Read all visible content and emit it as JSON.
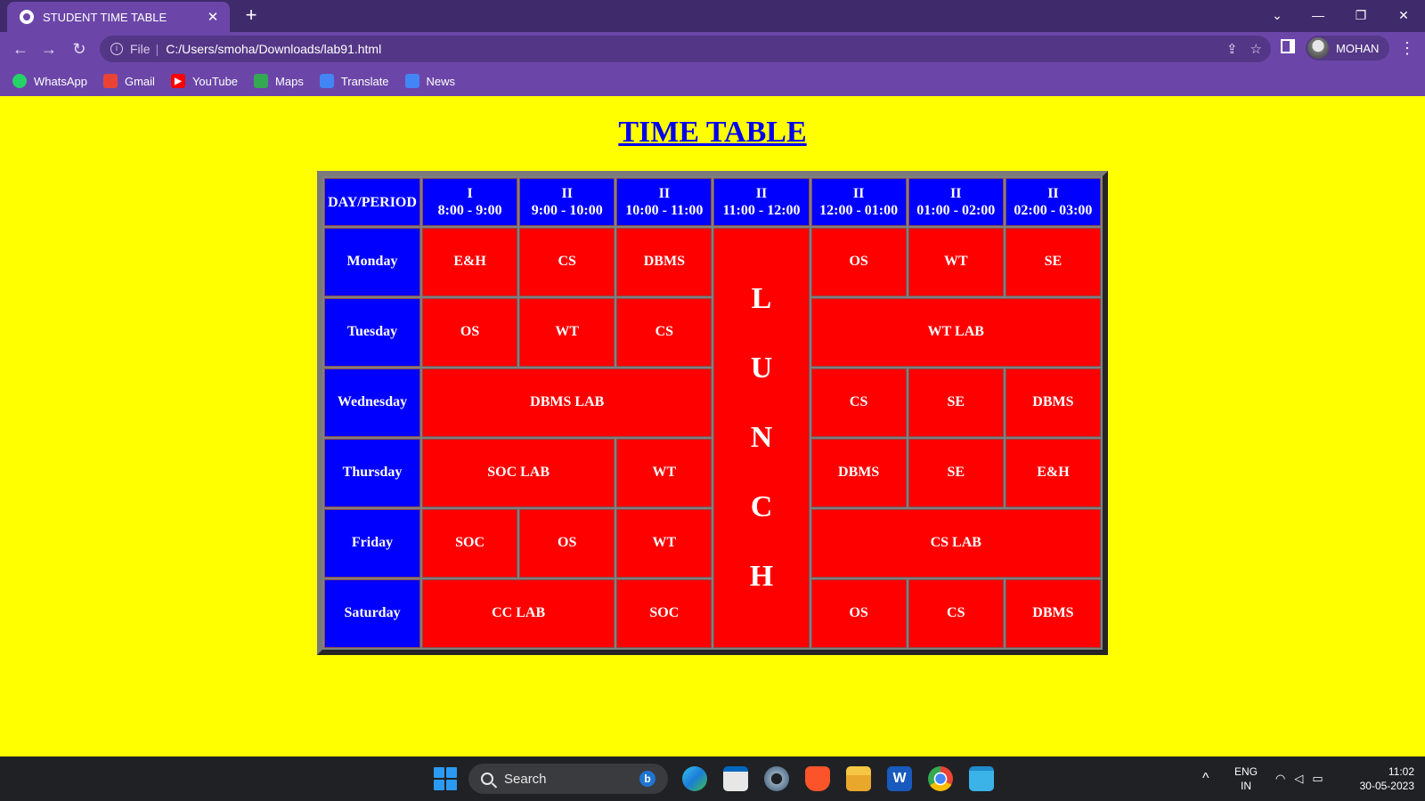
{
  "browser": {
    "tab_title": "STUDENT TIME TABLE",
    "tab_close": "✕",
    "new_tab": "+",
    "address_scheme": "File",
    "address_sep": "|",
    "address_url": "C:/Users/smoha/Downloads/lab91.html",
    "profile_name": "MOHAN",
    "window_controls": {
      "dropdown": "⌄",
      "minimize": "—",
      "restore": "❐",
      "close": "✕"
    },
    "nav": {
      "back": "←",
      "forward": "→",
      "reload": "↻"
    },
    "menu": "⋮",
    "omni_actions": {
      "share": "⇪",
      "star": "☆"
    }
  },
  "bookmarks": [
    {
      "label": "WhatsApp",
      "icon": "whatsapp-icon",
      "color": "#25d366"
    },
    {
      "label": "Gmail",
      "icon": "gmail-icon",
      "color": "#ea4335"
    },
    {
      "label": "YouTube",
      "icon": "youtube-icon",
      "color": "#ff0000"
    },
    {
      "label": "Maps",
      "icon": "maps-icon",
      "color": "#34a853"
    },
    {
      "label": "Translate",
      "icon": "translate-icon",
      "color": "#4285f4"
    },
    {
      "label": "News",
      "icon": "news-icon",
      "color": "#4285f4"
    }
  ],
  "page": {
    "title": "TIME TABLE",
    "colors": {
      "background": "#ffff00",
      "header": "#0000ff",
      "cell": "#ff0000",
      "title": "#0000ee"
    }
  },
  "timetable": {
    "corner": "DAY/PERIOD",
    "periods": [
      {
        "num": "I",
        "time": "8:00 - 9:00"
      },
      {
        "num": "II",
        "time": "9:00 - 10:00"
      },
      {
        "num": "II",
        "time": "10:00 - 11:00"
      },
      {
        "num": "II",
        "time": "11:00 - 12:00"
      },
      {
        "num": "II",
        "time": "12:00 - 01:00"
      },
      {
        "num": "II",
        "time": "01:00 - 02:00"
      },
      {
        "num": "II",
        "time": "02:00 - 03:00"
      }
    ],
    "lunch_letters": [
      "L",
      "U",
      "N",
      "C",
      "H"
    ],
    "days": {
      "monday": {
        "day": "Monday",
        "cells": [
          "E&H",
          "CS",
          "DBMS",
          "OS",
          "WT",
          "SE"
        ]
      },
      "tuesday": {
        "day": "Tuesday",
        "cells": [
          "OS",
          "WT",
          "CS",
          "WT LAB"
        ]
      },
      "wednesday": {
        "day": "Wednesday",
        "cells": [
          "DBMS LAB",
          "CS",
          "SE",
          "DBMS"
        ]
      },
      "thursday": {
        "day": "Thursday",
        "cells": [
          "SOC LAB",
          "WT",
          "DBMS",
          "SE",
          "E&H"
        ]
      },
      "friday": {
        "day": "Friday",
        "cells": [
          "SOC",
          "OS",
          "WT",
          "CS LAB"
        ]
      },
      "saturday": {
        "day": "Saturday",
        "cells": [
          "CC LAB",
          "SOC",
          "OS",
          "CS",
          "DBMS"
        ]
      }
    }
  },
  "taskbar": {
    "search_placeholder": "Search",
    "bing": "b",
    "lang_line1": "ENG",
    "lang_line2": "IN",
    "time": "11:02",
    "date": "30-05-2023",
    "chevron": "^",
    "apps": [
      "start-icon",
      "edge-icon",
      "store-icon",
      "settings-icon",
      "brave-icon",
      "file-explorer-icon",
      "word-icon",
      "chrome-icon",
      "notepad-icon"
    ]
  }
}
